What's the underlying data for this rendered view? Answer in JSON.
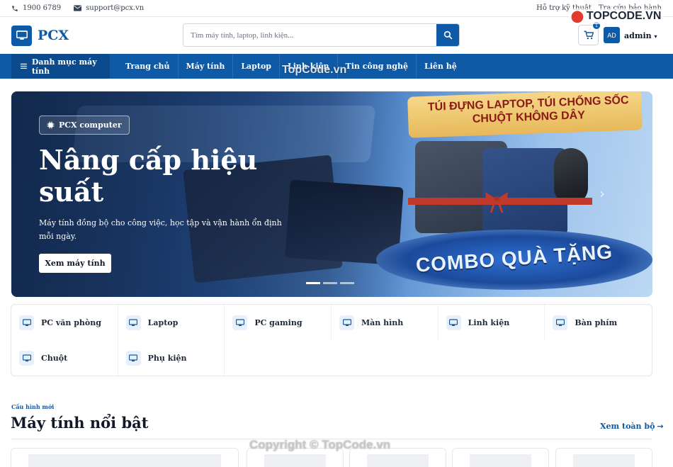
{
  "topbar": {
    "phone": "1900 6789",
    "email": "support@pcx.vn",
    "links": [
      "Hỗ trợ kỹ thuật",
      "Tra cứu bảo hành"
    ]
  },
  "header": {
    "logo_text": "PCX",
    "search_placeholder": "Tìm máy tính, laptop, linh kiện...",
    "cart_count": "1",
    "avatar_initials": "AD",
    "username": "admin"
  },
  "nav": {
    "category_label": "Danh mục máy tính",
    "links": [
      "Trang chủ",
      "Máy tính",
      "Laptop",
      "Linh kiện",
      "Tin công nghệ",
      "Liên hệ"
    ]
  },
  "banner": {
    "pill": "PCX computer",
    "title": "Nâng cấp hiệu suất",
    "description": "Máy tính đồng bộ cho công việc, học tập và vận hành ổn định mỗi ngày.",
    "cta": "Xem máy tính",
    "promo_top": "TÚI ĐỰNG LAPTOP, TÚI CHỐNG SỐC CHUỘT KHÔNG DÂY",
    "promo_bottom": "COMBO QUÀ TẶNG",
    "slides": 3,
    "active_slide": 1
  },
  "categories": [
    "PC văn phòng",
    "Laptop",
    "PC gaming",
    "Màn hình",
    "Linh kiện",
    "Bàn phím",
    "Chuột",
    "Phụ kiện"
  ],
  "featured": {
    "kicker": "Cấu hình mới",
    "title": "Máy tính nổi bật",
    "view_all": "Xem toàn bộ"
  },
  "watermarks": {
    "center": "TopCode.vn",
    "copyright": "Copyright © TopCode.vn",
    "brand": "TOPCODE.VN"
  },
  "colors": {
    "primary": "#0f5aa6",
    "primary_dark": "#0b4a8c"
  }
}
